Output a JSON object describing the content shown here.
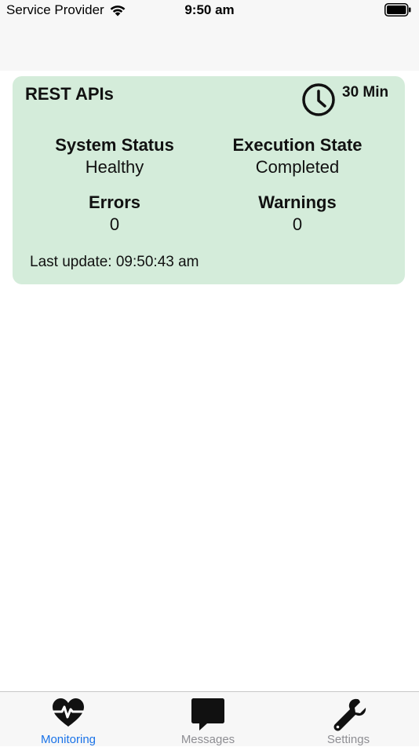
{
  "status_bar": {
    "carrier": "Service Provider",
    "time": "9:50 am"
  },
  "card": {
    "title": "REST APIs",
    "interval": "30 Min",
    "system_status_label": "System Status",
    "system_status_value": "Healthy",
    "execution_state_label": "Execution State",
    "execution_state_value": "Completed",
    "errors_label": "Errors",
    "errors_value": "0",
    "warnings_label": "Warnings",
    "warnings_value": "0",
    "last_update": "Last update: 09:50:43 am",
    "background_color": "#d4ecda"
  },
  "tab_bar": {
    "tabs": [
      {
        "label": "Monitoring",
        "icon": "heart-pulse-icon",
        "active": true
      },
      {
        "label": "Messages",
        "icon": "chat-bubble-icon",
        "active": false
      },
      {
        "label": "Settings",
        "icon": "wrench-icon",
        "active": false
      }
    ],
    "active_color": "#1a73e8",
    "inactive_color": "#8e8e93"
  }
}
